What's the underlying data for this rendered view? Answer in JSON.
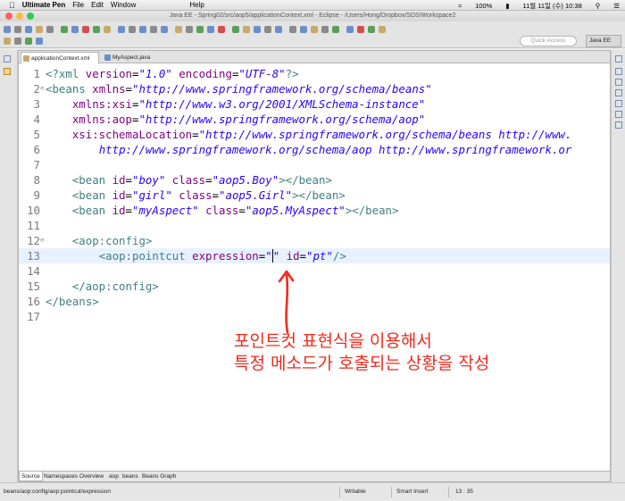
{
  "menubar": {
    "app_name": "Ultimate Pen",
    "items": [
      "File",
      "Edit",
      "Window",
      "Help"
    ],
    "battery": "100%",
    "datetime": "11월 11일 (수)  10:38"
  },
  "window": {
    "title": "Java EE - Spring02/src/aop5/applicationContext.xml - Eclipse - /Users/Hong/Dropbox/SDS/Workspace2"
  },
  "toolbar": {
    "quick_access_placeholder": "Quick Access",
    "perspective_label": "Java EE"
  },
  "editor": {
    "tabs": [
      {
        "label": "applicationContext.xml"
      },
      {
        "label": "MyAspect.java"
      }
    ],
    "cursor_line": 13,
    "bottom_tabs": [
      "Source",
      "Namespaces",
      "Overview",
      "aop",
      "beans",
      "Beans Graph"
    ]
  },
  "annotation": {
    "line1": "포인트컷 표현식을 이용해서",
    "line2": "특정 메소드가 호출되는 상황을 작성",
    "color": "#f22a1c"
  },
  "statusbar": {
    "breadcrumb": "beans/aop:config/aop:pointcut/expression",
    "mode": "Writable",
    "insert": "Smart Insert",
    "position": "13 : 35"
  }
}
